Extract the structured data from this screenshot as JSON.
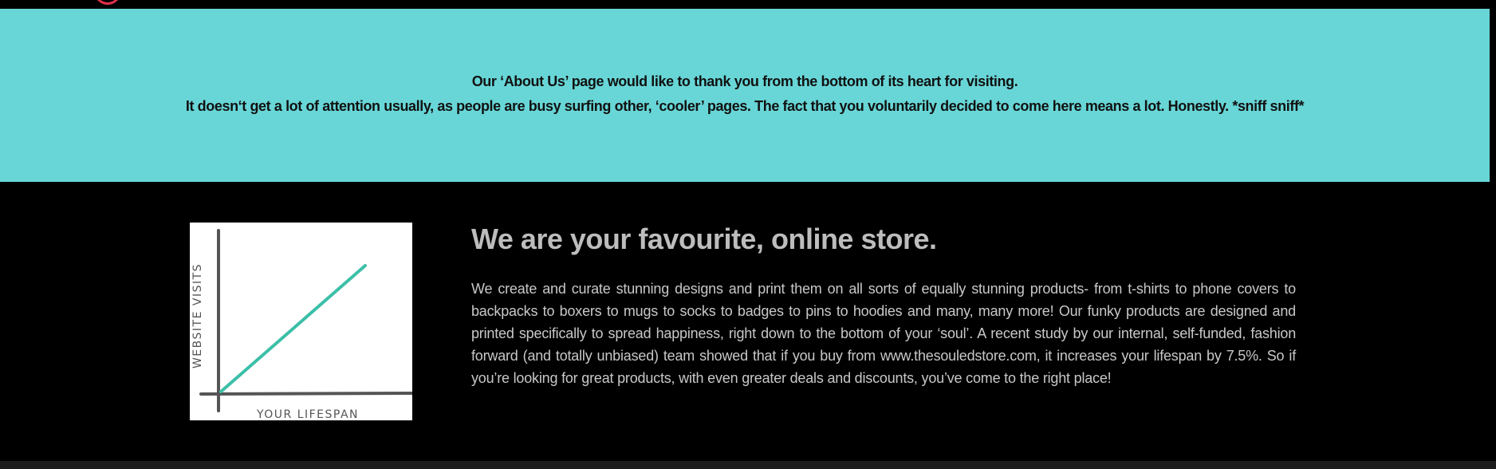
{
  "banner": {
    "line1": "Our ‘About Us’ page would like to thank you from the bottom of its heart for visiting.",
    "line2": "It doesn‘t get a lot of attention usually, as people are busy surfing other, ‘cooler’ pages. The fact that you voluntarily decided to come here means a lot. Honestly. *sniff sniff*",
    "background_color": "#68d6d7"
  },
  "illustration": {
    "y_label": "WEBSITE VISITS",
    "x_label": "YOUR LIFESPAN",
    "line_color": "#3cbfa8",
    "axis_color": "#555555"
  },
  "about": {
    "heading": "We are your favourite, online store.",
    "body": "We create and curate stunning designs and print them on all sorts of equally stunning products- from t-shirts to phone covers to backpacks to boxers to mugs to socks to badges to pins to hoodies and many, many more! Our funky products are designed and printed specifically to spread happiness, right down to the bottom of your ‘soul’. A recent study by our internal, self-funded, fashion forward (and totally unbiased) team showed that if you buy from www.thesouledstore.com, it increases your lifespan by 7.5%. So if you’re looking for great products, with even greater deals and discounts, you’ve come to the right place!"
  }
}
